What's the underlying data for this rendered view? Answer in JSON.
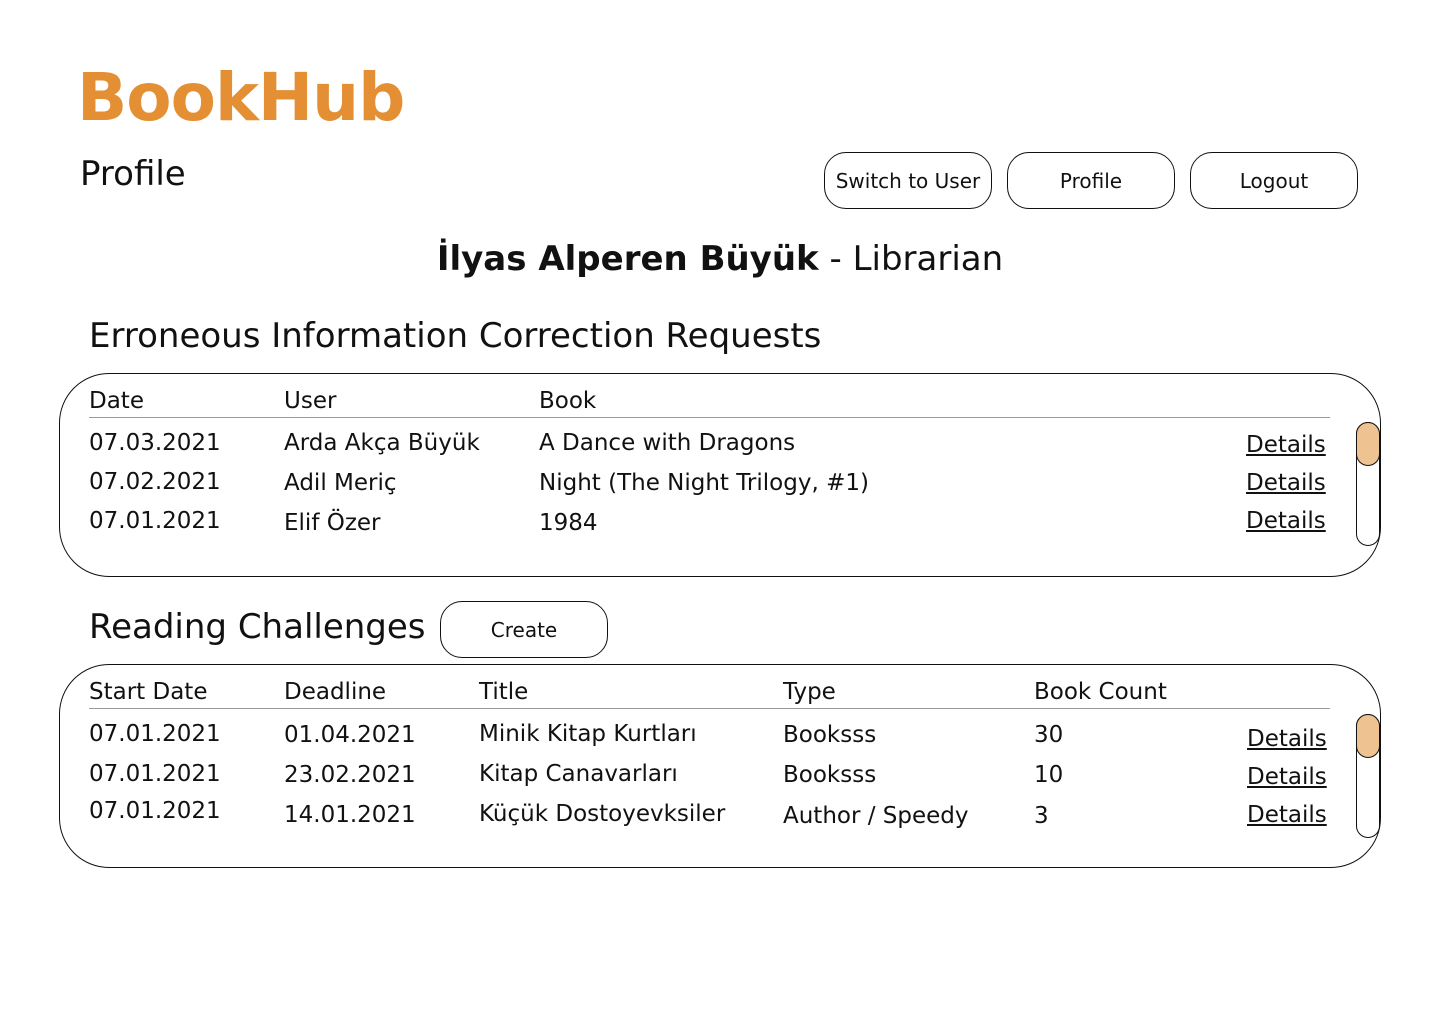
{
  "app": {
    "name": "BookHub",
    "brand_color": "#e48f33"
  },
  "header": {
    "page_title": "Profile"
  },
  "nav": {
    "switch_label": "Switch to User",
    "profile_label": "Profile",
    "logout_label": "Logout"
  },
  "user": {
    "name": "İlyas Alperen Büyük",
    "separator": " - ",
    "role": "Librarian"
  },
  "corrections": {
    "title": "Erroneous Information Correction Requests",
    "columns": [
      "Date",
      "User",
      "Book"
    ],
    "rows": [
      {
        "date": "07.03.2021",
        "user": "Arda Akça Büyük",
        "book": "A Dance with Dragons",
        "action": "Details"
      },
      {
        "date": "07.02.2021",
        "user": "Adil Meriç",
        "book": "Night (The Night Trilogy, #1)",
        "action": "Details"
      },
      {
        "date": "07.01.2021",
        "user": "Elif Özer",
        "book": "1984",
        "action": "Details"
      }
    ]
  },
  "challenges": {
    "title": "Reading Challenges",
    "create_label": "Create",
    "columns": [
      "Start Date",
      "Deadline",
      "Title",
      "Type",
      "Book Count"
    ],
    "rows": [
      {
        "start": "07.01.2021",
        "deadline": "01.04.2021",
        "title": "Minik Kitap Kurtları",
        "type": "Booksss",
        "count": "30",
        "action": "Details"
      },
      {
        "start": "07.01.2021",
        "deadline": "23.02.2021",
        "title": "Kitap Canavarları",
        "type": "Booksss",
        "count": "10",
        "action": "Details"
      },
      {
        "start": "07.01.2021",
        "deadline": "14.01.2021",
        "title": "Küçük Dostoyevksiler",
        "type": "Author / Speedy",
        "count": "3",
        "action": "Details"
      }
    ]
  },
  "scrollbar_thumb_color": "#eec391"
}
